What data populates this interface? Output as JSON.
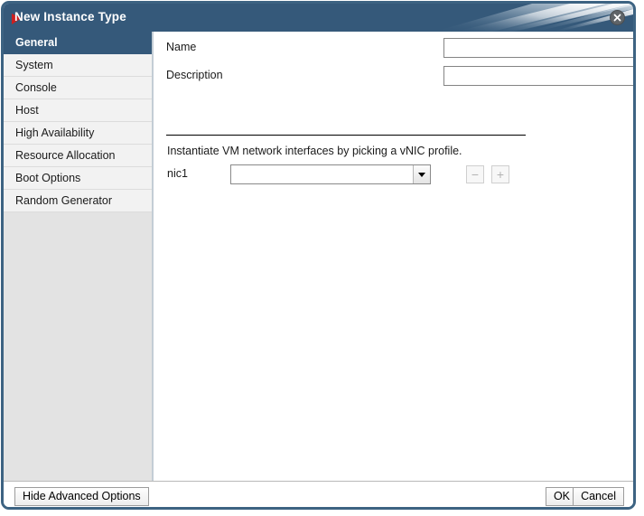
{
  "window": {
    "title": "New Instance Type",
    "close_icon": "close-icon"
  },
  "sidebar": {
    "items": [
      {
        "label": "General",
        "selected": true
      },
      {
        "label": "System",
        "selected": false
      },
      {
        "label": "Console",
        "selected": false
      },
      {
        "label": "Host",
        "selected": false
      },
      {
        "label": "High Availability",
        "selected": false
      },
      {
        "label": "Resource Allocation",
        "selected": false
      },
      {
        "label": "Boot Options",
        "selected": false
      },
      {
        "label": "Random Generator",
        "selected": false
      }
    ]
  },
  "general_tab": {
    "name_label": "Name",
    "name_value": "",
    "name_placeholder": "",
    "description_label": "Description",
    "description_value": "",
    "description_placeholder": "",
    "nic_hint": "Instantiate VM network interfaces by picking a vNIC profile.",
    "nic_label": "nic1",
    "nic_profile_value": "",
    "nic_remove_label": "−",
    "nic_add_label": "+",
    "dropdown_icon": "chevron-down-icon"
  },
  "footer": {
    "hide_advanced_label": "Hide Advanced Options",
    "ok_label": "OK",
    "cancel_label": "Cancel"
  },
  "colors": {
    "title_bar": "#35597a",
    "frame_border": "#3d6382",
    "selected_item": "#35597a",
    "sidebar_background": "#e3e3e3",
    "title_marker": "#cc1f1f"
  }
}
